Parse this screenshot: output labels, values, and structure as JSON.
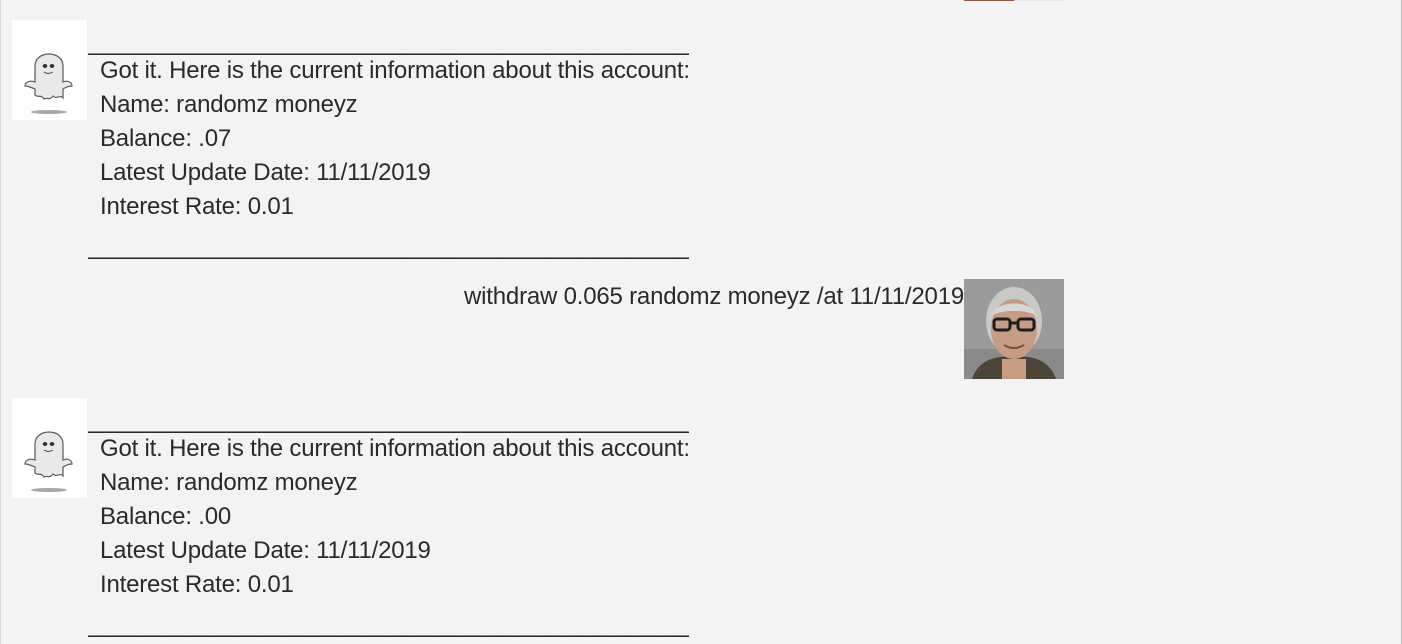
{
  "conversation": {
    "bot_divider": "___________________________________________________",
    "messages": [
      {
        "sender": "bot",
        "icon": "ghost-icon",
        "lines": [
          "Got it. Here is the current information about this account:",
          "Name: randomz moneyz",
          "Balance: .07",
          "Latest Update Date: 11/11/2019",
          "Interest Rate: 0.01"
        ]
      },
      {
        "sender": "user",
        "icon": "user-avatar",
        "text": "withdraw 0.065 randomz moneyz /at 11/11/2019"
      },
      {
        "sender": "bot",
        "icon": "ghost-icon",
        "lines": [
          "Got it. Here is the current information about this account:",
          "Name: randomz moneyz",
          "Balance: .00",
          "Latest Update Date: 11/11/2019",
          "Interest Rate: 0.01"
        ]
      }
    ]
  }
}
